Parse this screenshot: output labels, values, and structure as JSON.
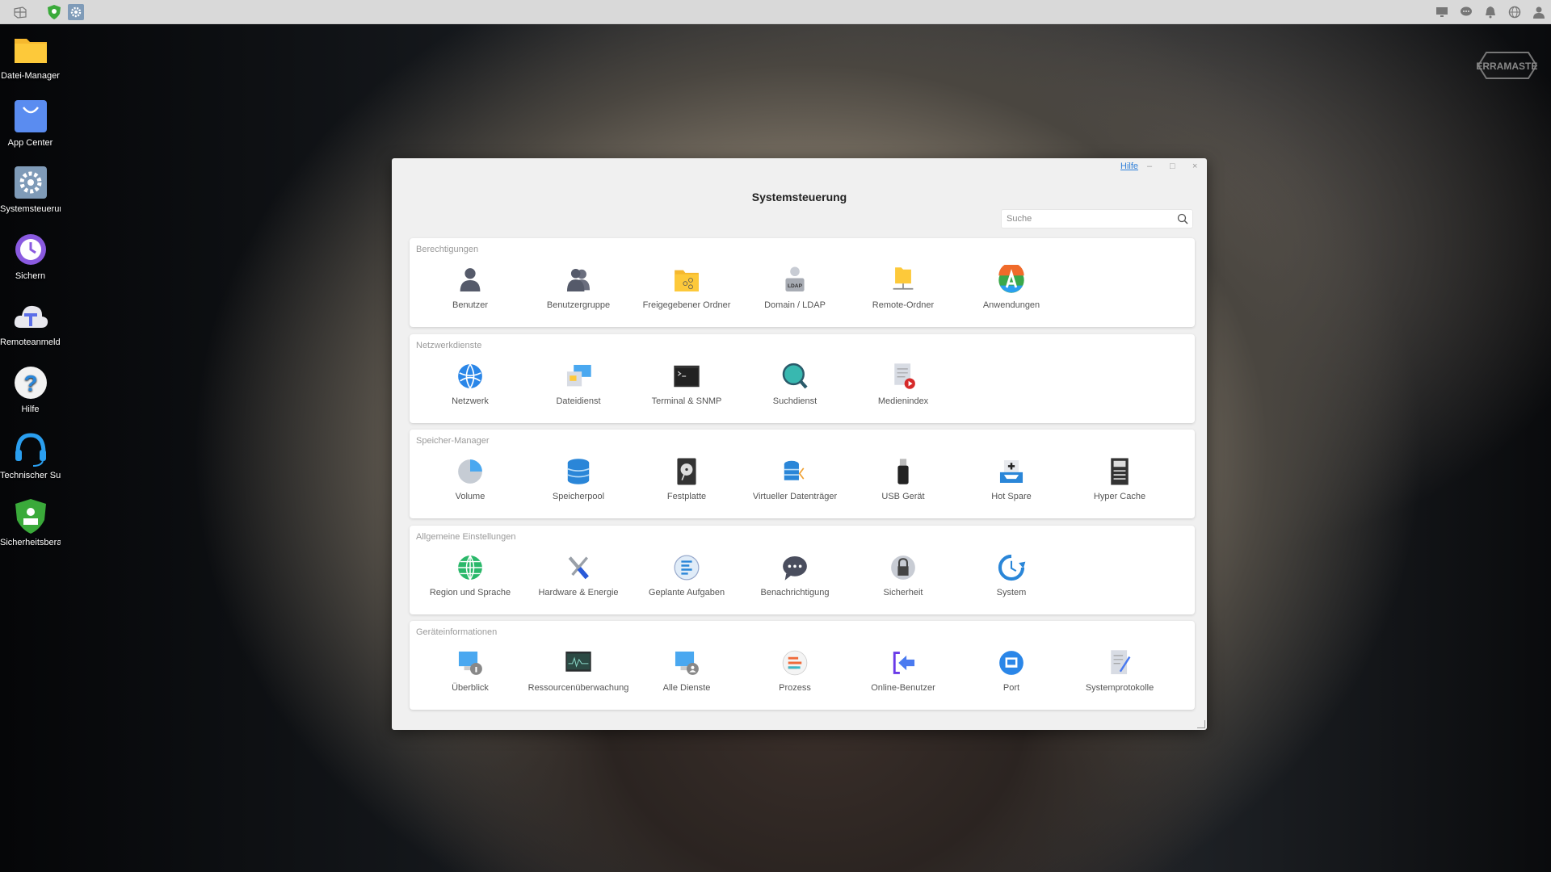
{
  "taskbar": {
    "left": [
      {
        "icon": "windows-start-icon"
      },
      {
        "icon": "security-shield-icon"
      },
      {
        "icon": "settings-gear-icon"
      }
    ],
    "right": [
      {
        "icon": "monitor-icon"
      },
      {
        "icon": "chat-icon"
      },
      {
        "icon": "bell-icon"
      },
      {
        "icon": "globe-icon"
      },
      {
        "icon": "user-icon"
      }
    ]
  },
  "brand": "TERRAMASTER",
  "desktop": [
    {
      "label": "Datei-Manager",
      "icon": "folder"
    },
    {
      "label": "App Center",
      "icon": "appcenter"
    },
    {
      "label": "Systemsteuerun",
      "icon": "gear"
    },
    {
      "label": "Sichern",
      "icon": "backup"
    },
    {
      "label": "Remoteanmeldu",
      "icon": "cloud"
    },
    {
      "label": "Hilfe",
      "icon": "help"
    },
    {
      "label": "Technischer Support",
      "icon": "headset"
    },
    {
      "label": "Sicherheitsberat",
      "icon": "shield"
    }
  ],
  "window": {
    "help": "Hilfe",
    "minimize": "–",
    "maximize": "□",
    "close": "×",
    "title": "Systemsteuerung",
    "search_placeholder": "Suche",
    "sections": [
      {
        "title": "Berechtigungen",
        "items": [
          {
            "label": "Benutzer",
            "icon": "user"
          },
          {
            "label": "Benutzergruppe",
            "icon": "group"
          },
          {
            "label": "Freigegebener Ordner",
            "icon": "sharedfolder"
          },
          {
            "label": "Domain / LDAP",
            "icon": "ldap"
          },
          {
            "label": "Remote-Ordner",
            "icon": "remotefolder"
          },
          {
            "label": "Anwendungen",
            "icon": "apps"
          }
        ]
      },
      {
        "title": "Netzwerkdienste",
        "items": [
          {
            "label": "Netzwerk",
            "icon": "network"
          },
          {
            "label": "Dateidienst",
            "icon": "fileservice"
          },
          {
            "label": "Terminal & SNMP",
            "icon": "terminal"
          },
          {
            "label": "Suchdienst",
            "icon": "searchsvc"
          },
          {
            "label": "Medienindex",
            "icon": "media"
          }
        ]
      },
      {
        "title": "Speicher-Manager",
        "items": [
          {
            "label": "Volume",
            "icon": "volume"
          },
          {
            "label": "Speicherpool",
            "icon": "pool"
          },
          {
            "label": "Festplatte",
            "icon": "disk"
          },
          {
            "label": "Virtueller Datenträger",
            "icon": "vdisk"
          },
          {
            "label": "USB Gerät",
            "icon": "usb"
          },
          {
            "label": "Hot Spare",
            "icon": "hotspare"
          },
          {
            "label": "Hyper Cache",
            "icon": "ssd"
          }
        ]
      },
      {
        "title": "Allgemeine Einstellungen",
        "items": [
          {
            "label": "Region und Sprache",
            "icon": "region"
          },
          {
            "label": "Hardware & Energie",
            "icon": "tools"
          },
          {
            "label": "Geplante Aufgaben",
            "icon": "tasks"
          },
          {
            "label": "Benachrichtigung",
            "icon": "notify"
          },
          {
            "label": "Sicherheit",
            "icon": "lock"
          },
          {
            "label": "System",
            "icon": "system"
          }
        ]
      },
      {
        "title": "Geräteinformationen",
        "items": [
          {
            "label": "Überblick",
            "icon": "overview"
          },
          {
            "label": "Ressourcenüberwachung",
            "icon": "monitor"
          },
          {
            "label": "Alle Dienste",
            "icon": "services"
          },
          {
            "label": "Prozess",
            "icon": "process"
          },
          {
            "label": "Online-Benutzer",
            "icon": "online"
          },
          {
            "label": "Port",
            "icon": "port"
          },
          {
            "label": "Systemprotokolle",
            "icon": "logs"
          }
        ]
      }
    ]
  },
  "colors": {
    "accent": "#2f7fd8",
    "topbar": "#d9d9d9",
    "window": "#f0f0f0"
  }
}
